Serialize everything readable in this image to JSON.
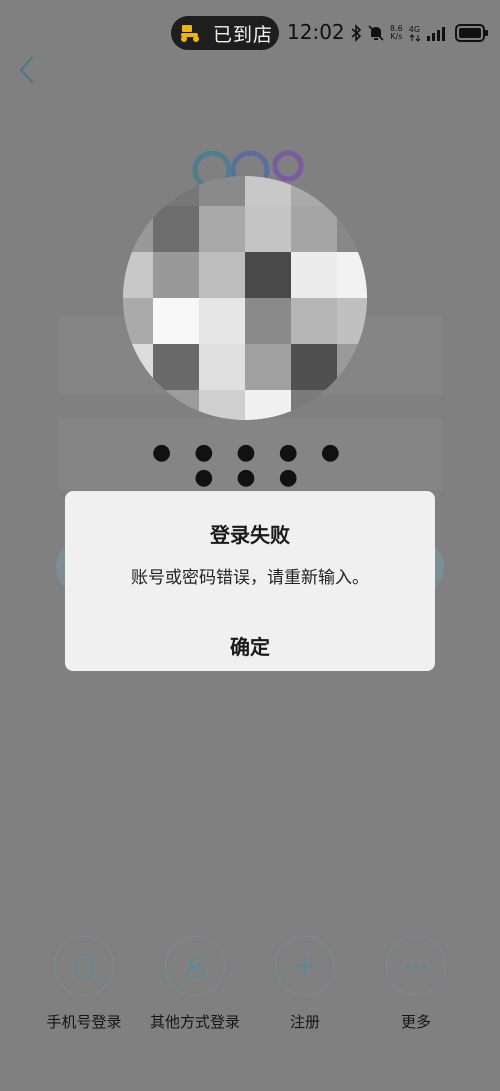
{
  "status_bar": {
    "pill_text": "已到店",
    "time": "12:02",
    "net_speed_value": "8.6",
    "net_speed_unit": "K/s",
    "network_type": "4G",
    "icons": [
      "scooter-icon",
      "bluetooth-icon",
      "bell-muted-icon",
      "signal-icon",
      "battery-icon"
    ]
  },
  "nav": {
    "back_icon": "chevron-left-icon"
  },
  "login": {
    "password_mask": "● ● ● ● ● ● ● ●"
  },
  "dialog": {
    "title": "登录失败",
    "message": "账号或密码错误，请重新输入。",
    "ok_label": "确定"
  },
  "bottom_options": [
    {
      "label": "手机号登录",
      "icon": "phone-icon"
    },
    {
      "label": "其他方式登录",
      "icon": "person-icon"
    },
    {
      "label": "注册",
      "icon": "plus-icon"
    },
    {
      "label": "更多",
      "icon": "more-dots-icon"
    }
  ],
  "colors": {
    "overlay": "#808080",
    "accent": "#5b8a96",
    "dialog_bg": "#f0f0f0"
  }
}
